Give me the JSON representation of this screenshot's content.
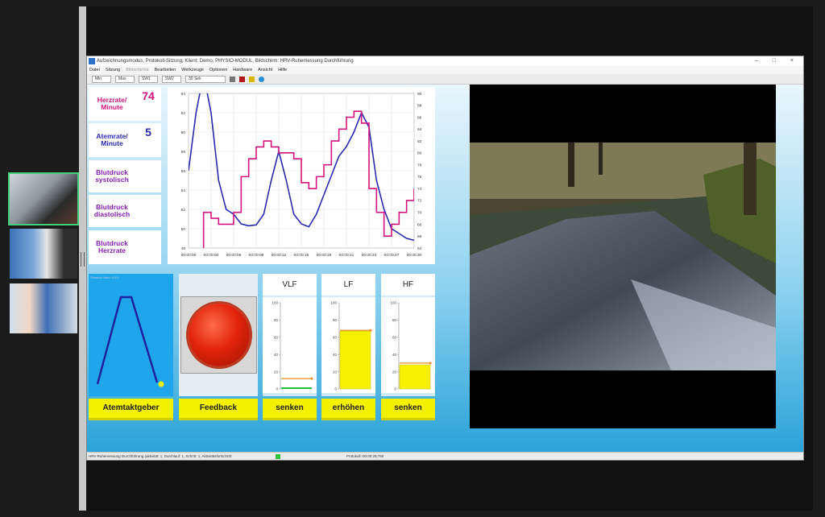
{
  "window": {
    "title": "Aufzeichnungsmodus, Protokoll-Sitzung, Klient: Demo, PHYSIO-MODUL, Bildschirm: HRV-Ruhemessung Durchführung",
    "controls": "– □ ×"
  },
  "menu": [
    "Datei",
    "Sitzung",
    "Bildschirme",
    "Bearbeiten",
    "Werkzeuge",
    "Optionen",
    "Hardware",
    "Ansicht",
    "Hilfe"
  ],
  "toolbar": {
    "min_label": "Min",
    "max_label": "Max",
    "sw1_label": "SW1",
    "sw2_label": "SW2",
    "time_label": "30 Sek"
  },
  "vitals": [
    {
      "label": "Herzrate/ Minute",
      "value": "74",
      "color": "#d4137f"
    },
    {
      "label": "Atemrate/ Minute",
      "value": "5",
      "color": "#2a2ab0"
    },
    {
      "label": "Blutdruck systolisch",
      "value": "",
      "color": "#8a1fb5"
    },
    {
      "label": "Blutdruck diastolisch",
      "value": "",
      "color": "#8a1fb5"
    },
    {
      "label": "Blutdruck Herzrate",
      "value": "",
      "color": "#8a1fb5"
    }
  ],
  "chart_data": {
    "type": "line",
    "x_ticks": [
      "00:00:00",
      "00:00:03",
      "00:00:06",
      "00:00:09",
      "00:00:12",
      "00:00:15",
      "00:00:18",
      "00:00:21",
      "00:00:24",
      "00:00:27",
      "00:00:30"
    ],
    "y_left_ticks": [
      "48",
      "50",
      "52",
      "54",
      "56",
      "58",
      "60",
      "62",
      "64"
    ],
    "y_right_ticks": [
      "64",
      "66",
      "68",
      "70",
      "72",
      "74",
      "76",
      "78",
      "80",
      "82",
      "84",
      "86",
      "88",
      "90"
    ],
    "series": [
      {
        "color": "#2a2ab0",
        "axis": "left",
        "x": [
          0,
          1,
          2,
          3,
          4,
          5,
          6,
          7,
          8,
          9,
          10,
          11,
          12,
          13,
          14,
          15,
          16,
          17,
          18,
          19,
          20,
          21,
          22,
          23,
          24,
          25,
          26,
          27,
          28,
          29,
          30
        ],
        "values": [
          56,
          62,
          66,
          62,
          55,
          52,
          51.5,
          50.5,
          50.3,
          50.4,
          51.5,
          55,
          58,
          55,
          51.5,
          50.5,
          50.2,
          51.5,
          53.5,
          55.5,
          57.5,
          58.5,
          60,
          62,
          60.5,
          55,
          52,
          50,
          49.5,
          49,
          48.8
        ]
      },
      {
        "color": "#d4137f",
        "axis": "right",
        "x": [
          1,
          2,
          3,
          4,
          5,
          6,
          7,
          8,
          9,
          10,
          11,
          12,
          13,
          14,
          15,
          16,
          17,
          18,
          19,
          20,
          21,
          22,
          23,
          24,
          25,
          26,
          27,
          28,
          29,
          30
        ],
        "values": [
          60,
          70,
          69,
          68,
          68,
          70,
          76,
          79,
          81,
          82,
          81,
          80,
          80,
          79,
          75,
          74,
          76,
          78,
          82,
          84,
          86,
          87,
          85,
          74,
          70,
          66,
          68,
          70,
          72,
          74
        ]
      }
    ]
  },
  "breath_pacer": {
    "title": "Stimulus Atem 5,5/1",
    "button": "Atemtaktgeber"
  },
  "feedback": {
    "button": "Feedback"
  },
  "bands": [
    {
      "name": "VLF",
      "value": 8,
      "target": 12,
      "action": "senken"
    },
    {
      "name": "LF",
      "value": 67,
      "target": 68,
      "action": "erhöhen"
    },
    {
      "name": "HF",
      "value": 28,
      "target": 30,
      "action": "senken"
    }
  ],
  "band_axis_ticks": [
    "0",
    "20",
    "40",
    "60",
    "80",
    "100"
  ],
  "statusbar": {
    "text": "HRV-Ruhemessung Durchführung (aktivität: 1, Durchlauf: 1, Schritt: 1, Aktivitätsfortschritt:",
    "time": "Protokoll: 00:00:29,750"
  },
  "colors": {
    "accent_yellow": "#f3f000",
    "band_fill": "#f7f000",
    "band_target": "#f08a20",
    "vlf_fill": "#22c33a"
  }
}
